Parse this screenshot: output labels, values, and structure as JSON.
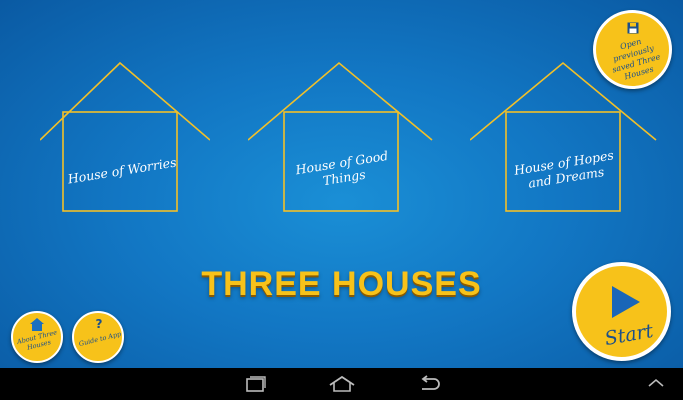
{
  "title": "THREE HOUSES",
  "houses": [
    {
      "label": "House of Worries"
    },
    {
      "label": "House of Good Things"
    },
    {
      "label": "House of Hopes and Dreams"
    }
  ],
  "buttons": {
    "open_saved": "Open previously saved Three Houses",
    "start": "Start",
    "about": "About Three Houses",
    "guide": "Guide to App",
    "guide_icon_glyph": "?"
  },
  "icons": {
    "open_saved": "floppy-disk-icon",
    "start": "play-icon",
    "about": "house-icon",
    "guide": "question-mark-icon",
    "nav_recents": "recent-apps-icon",
    "nav_home": "home-icon",
    "nav_back": "back-icon",
    "nav_up": "chevron-up-icon"
  },
  "colors": {
    "background": "#1277c4",
    "accent": "#f7c21a",
    "button_text": "#1b4f8a",
    "house_outline": "#f2c029",
    "navbar": "#000000"
  }
}
